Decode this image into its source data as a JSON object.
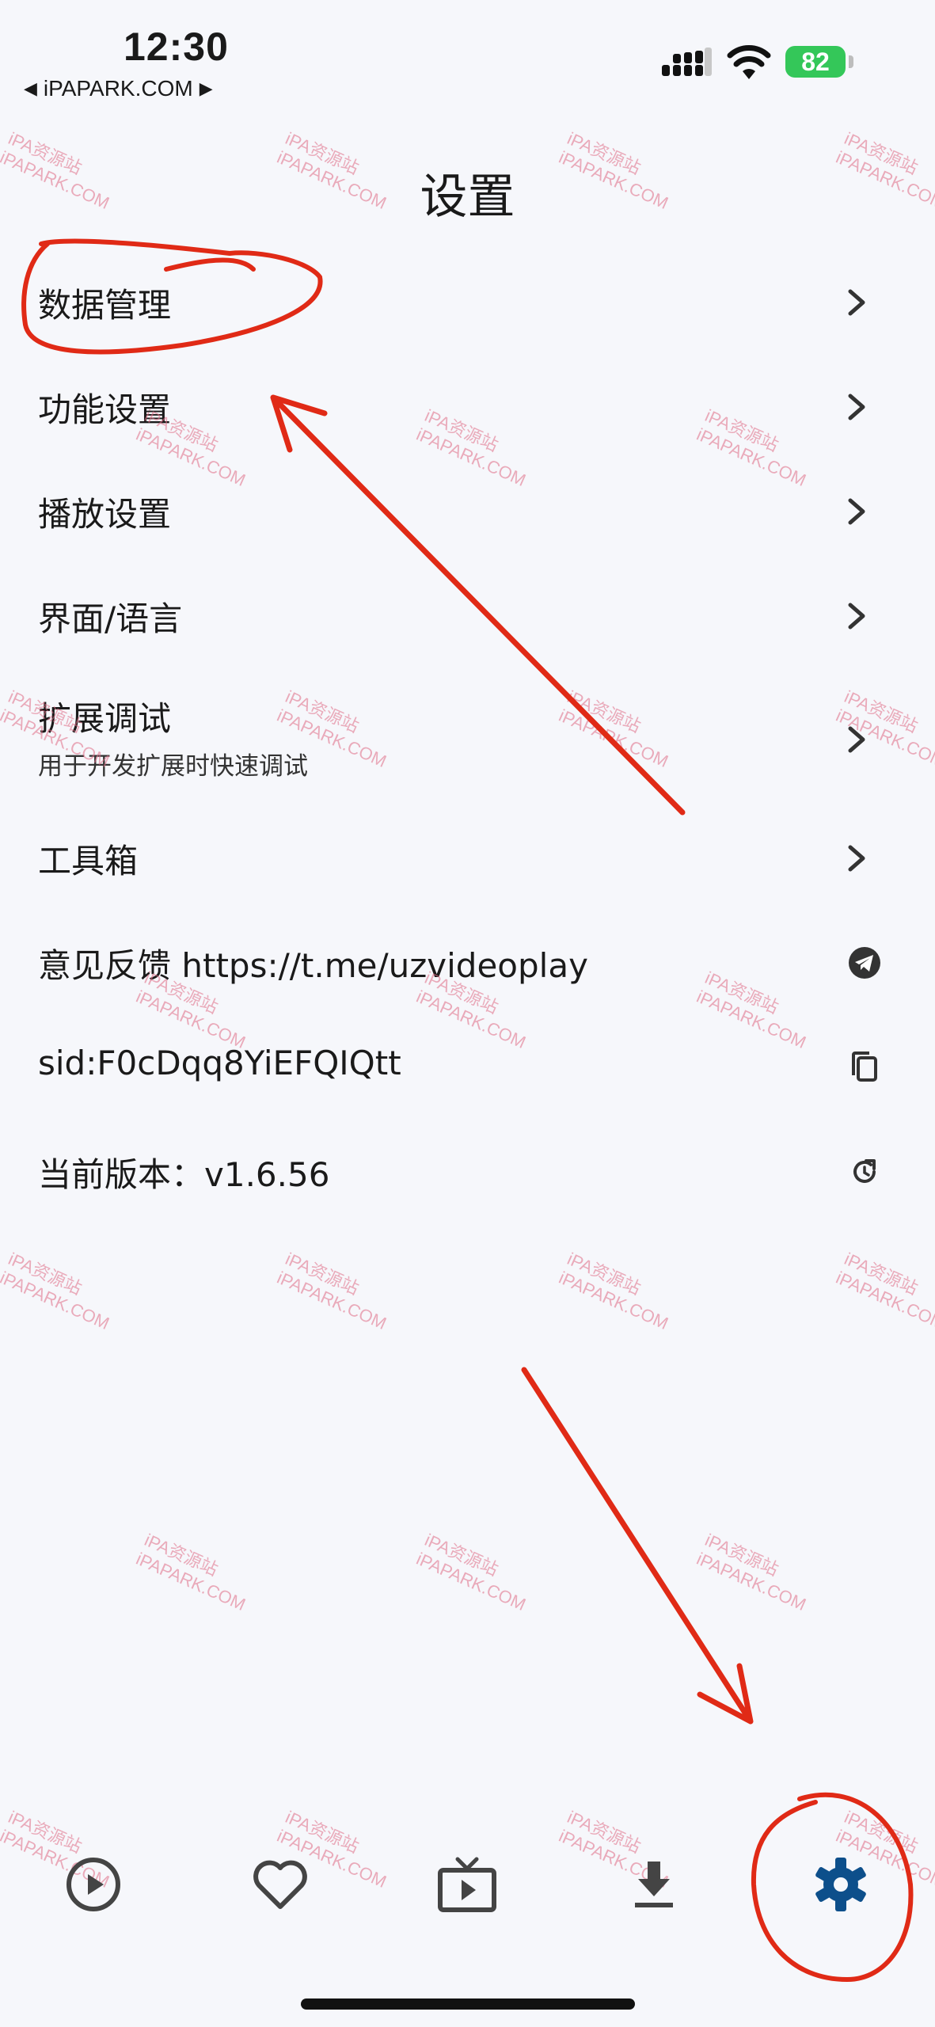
{
  "status": {
    "time": "12:30",
    "back_label": "iPAPARK.COM",
    "battery": "82"
  },
  "page_title": "设置",
  "menu": [
    {
      "label": "数据管理",
      "icon": "chevron-right-icon"
    },
    {
      "label": "功能设置",
      "icon": "chevron-right-icon"
    },
    {
      "label": "播放设置",
      "icon": "chevron-right-icon"
    },
    {
      "label": "界面/语言",
      "icon": "chevron-right-icon"
    },
    {
      "label": "扩展调试",
      "subtitle": "用于开发扩展时快速调试",
      "icon": "chevron-right-icon"
    },
    {
      "label": "工具箱",
      "icon": "chevron-right-icon"
    },
    {
      "label": "意见反馈 https://t.me/uzvideoplay",
      "icon": "telegram-icon"
    },
    {
      "label": "sid:F0cDqq8YiEFQIQtt",
      "icon": "copy-icon"
    },
    {
      "label": "当前版本：v1.6.56",
      "icon": "refresh-icon"
    }
  ],
  "tabs": [
    {
      "name": "play",
      "icon": "play-circle-icon"
    },
    {
      "name": "favorites",
      "icon": "heart-icon"
    },
    {
      "name": "live",
      "icon": "tv-icon"
    },
    {
      "name": "downloads",
      "icon": "download-icon"
    },
    {
      "name": "settings",
      "icon": "gear-icon",
      "active": true
    }
  ],
  "watermark": {
    "line1": "iPA资源站",
    "line2": "iPAPARK.COM"
  },
  "colors": {
    "background": "#f6f7fb",
    "active_tab": "#0d4f8b",
    "annotation": "#e02a16",
    "battery": "#34c759"
  }
}
